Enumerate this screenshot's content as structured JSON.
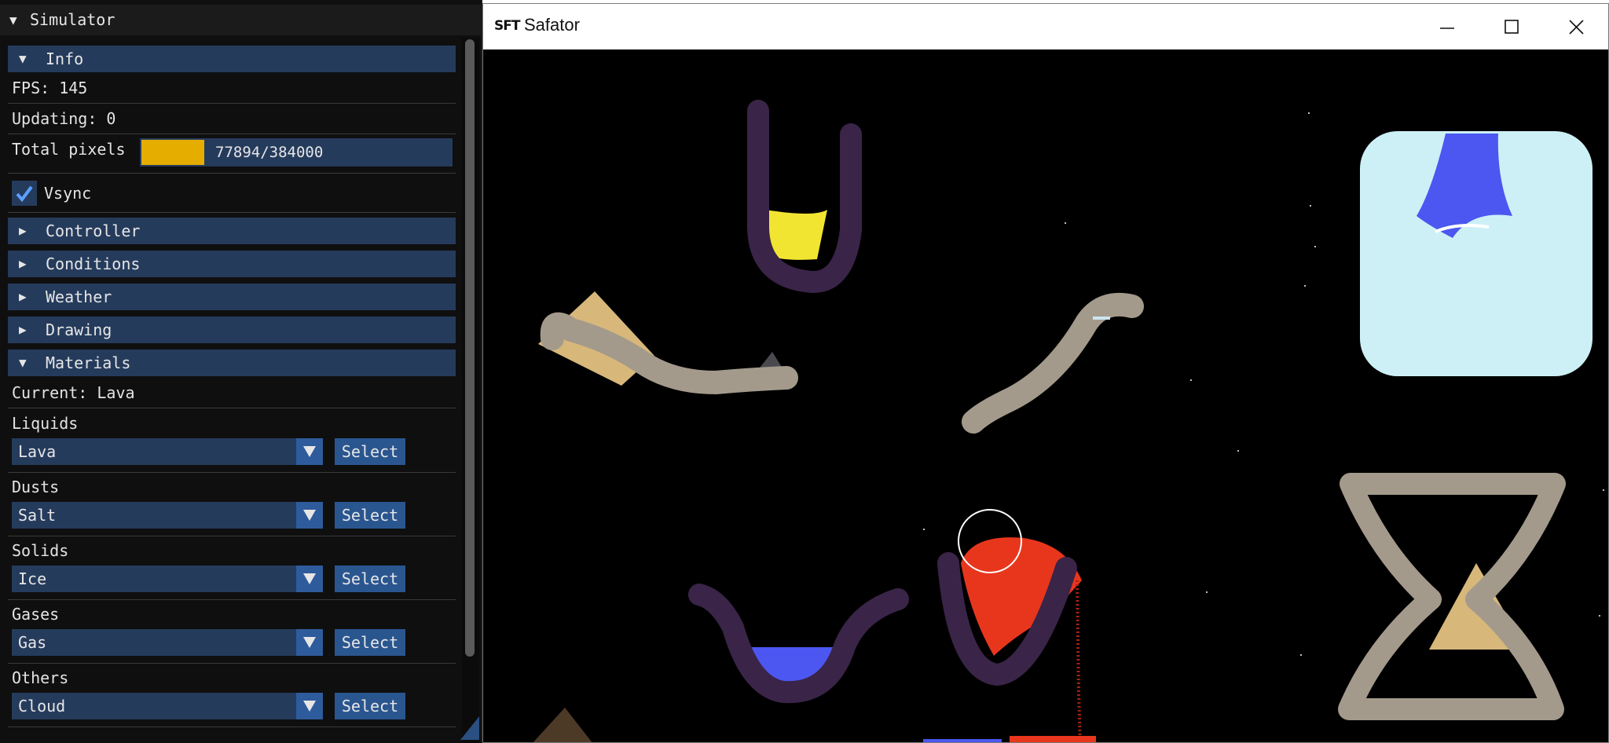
{
  "panel": {
    "title": "Simulator",
    "info": {
      "header": "Info",
      "fps": "FPS: 145",
      "updating": "Updating: 0",
      "total_pixels_label": "Total pixels",
      "total_pixels_value": "77894/384000",
      "total_pixels_fraction": 0.203,
      "vsync_label": "Vsync",
      "vsync_checked": true
    },
    "sections": [
      "Controller",
      "Conditions",
      "Weather",
      "Drawing"
    ],
    "materials": {
      "header": "Materials",
      "current": "Current: Lava",
      "groups": [
        {
          "label": "Liquids",
          "value": "Lava",
          "button": "Select"
        },
        {
          "label": "Dusts",
          "value": "Salt",
          "button": "Select"
        },
        {
          "label": "Solids",
          "value": "Ice",
          "button": "Select"
        },
        {
          "label": "Gases",
          "value": "Gas",
          "button": "Select"
        },
        {
          "label": "Others",
          "value": "Cloud",
          "button": "Select"
        }
      ]
    }
  },
  "window": {
    "logo": "SFT",
    "title": "Safator"
  },
  "colors": {
    "panel_bg": "#0f0f0f",
    "header_bg": "#253b5c",
    "accent": "#2e5b9c",
    "progress_fill": "#e5ad00",
    "stone": "#a39a8c",
    "wall": "#3a2448",
    "sand": "#d7b87a",
    "water": "#4b57f0",
    "lava": "#e8361c",
    "ice": "#cdf0f6",
    "yellow": "#f2e532"
  }
}
